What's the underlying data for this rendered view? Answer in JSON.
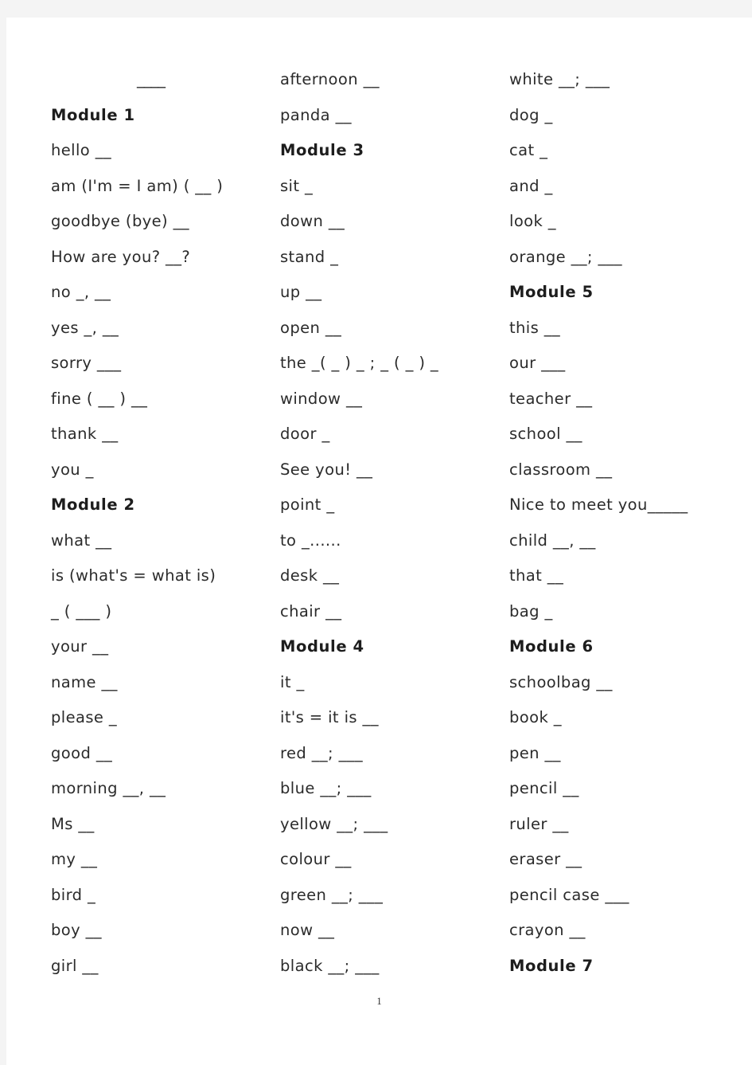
{
  "document": {
    "page_number": "1",
    "background_color": "#f4f4f4",
    "page_color": "#ffffff",
    "text_color": "#2b2b2b"
  },
  "columns": [
    {
      "id": "column-1",
      "entries": [
        {
          "text": "____",
          "type": "rule"
        },
        {
          "text": "Module 1",
          "type": "module"
        },
        {
          "text": "hello __",
          "type": "word"
        },
        {
          "text": "am (I'm = I am) ( __ )",
          "type": "word"
        },
        {
          "text": "goodbye (bye) __",
          "type": "word"
        },
        {
          "text": "How are you? __?",
          "type": "word"
        },
        {
          "text": "no _, __",
          "type": "word"
        },
        {
          "text": "yes _, __",
          "type": "word"
        },
        {
          "text": "sorry ___",
          "type": "word"
        },
        {
          "text": "fine ( __ ) __",
          "type": "word"
        },
        {
          "text": "thank __",
          "type": "word"
        },
        {
          "text": "you _",
          "type": "word"
        },
        {
          "text": "Module 2",
          "type": "module"
        },
        {
          "text": "what __",
          "type": "word"
        },
        {
          "text": "is (what's = what is)",
          "type": "word"
        },
        {
          "text": "_ ( ___ )",
          "type": "word"
        },
        {
          "text": "your __",
          "type": "word"
        },
        {
          "text": "name __",
          "type": "word"
        },
        {
          "text": "please _",
          "type": "word"
        },
        {
          "text": "good __",
          "type": "word"
        },
        {
          "text": "morning __, __",
          "type": "word"
        },
        {
          "text": "Ms __",
          "type": "word"
        },
        {
          "text": "my __",
          "type": "word"
        },
        {
          "text": "bird _",
          "type": "word"
        },
        {
          "text": "boy __",
          "type": "word"
        },
        {
          "text": "girl __",
          "type": "word"
        }
      ]
    },
    {
      "id": "column-2",
      "entries": [
        {
          "text": "afternoon __",
          "type": "word"
        },
        {
          "text": "panda __",
          "type": "word"
        },
        {
          "text": "Module 3",
          "type": "module"
        },
        {
          "text": "sit _",
          "type": "word"
        },
        {
          "text": "down __",
          "type": "word"
        },
        {
          "text": "stand _",
          "type": "word"
        },
        {
          "text": "up __",
          "type": "word"
        },
        {
          "text": "open __",
          "type": "word"
        },
        {
          "text": "the _( _ ) _ ; _ ( _ ) _",
          "type": "word"
        },
        {
          "text": "window __",
          "type": "word"
        },
        {
          "text": "door _",
          "type": "word"
        },
        {
          "text": "See you! __",
          "type": "word"
        },
        {
          "text": "point _",
          "type": "word"
        },
        {
          "text": "to _......",
          "type": "word"
        },
        {
          "text": "desk __",
          "type": "word"
        },
        {
          "text": "chair __",
          "type": "word"
        },
        {
          "text": "Module 4",
          "type": "module"
        },
        {
          "text": "it _",
          "type": "word"
        },
        {
          "text": "it's = it is __",
          "type": "word"
        },
        {
          "text": "red __; ___",
          "type": "word"
        },
        {
          "text": "blue __; ___",
          "type": "word"
        },
        {
          "text": "yellow __; ___",
          "type": "word"
        },
        {
          "text": "colour __",
          "type": "word"
        },
        {
          "text": "green __; ___",
          "type": "word"
        },
        {
          "text": "now __",
          "type": "word"
        },
        {
          "text": "black __; ___",
          "type": "word"
        }
      ]
    },
    {
      "id": "column-3",
      "entries": [
        {
          "text": "white __; ___",
          "type": "word"
        },
        {
          "text": "dog _",
          "type": "word"
        },
        {
          "text": "cat _",
          "type": "word"
        },
        {
          "text": "and _",
          "type": "word"
        },
        {
          "text": "look _",
          "type": "word"
        },
        {
          "text": "orange __; ___",
          "type": "word"
        },
        {
          "text": "Module 5",
          "type": "module"
        },
        {
          "text": "this __",
          "type": "word"
        },
        {
          "text": "our ___",
          "type": "word"
        },
        {
          "text": "teacher __",
          "type": "word"
        },
        {
          "text": "school __",
          "type": "word"
        },
        {
          "text": "classroom __",
          "type": "word"
        },
        {
          "text": "Nice to meet you_____",
          "type": "word"
        },
        {
          "text": "child __, __",
          "type": "word"
        },
        {
          "text": "that __",
          "type": "word"
        },
        {
          "text": "bag _",
          "type": "word"
        },
        {
          "text": "Module 6",
          "type": "module"
        },
        {
          "text": "schoolbag __",
          "type": "word"
        },
        {
          "text": "book _",
          "type": "word"
        },
        {
          "text": "pen __",
          "type": "word"
        },
        {
          "text": "pencil __",
          "type": "word"
        },
        {
          "text": "ruler __",
          "type": "word"
        },
        {
          "text": "eraser __",
          "type": "word"
        },
        {
          "text": "pencil case ___",
          "type": "word"
        },
        {
          "text": "crayon __",
          "type": "word"
        },
        {
          "text": "Module 7",
          "type": "module"
        }
      ]
    }
  ]
}
